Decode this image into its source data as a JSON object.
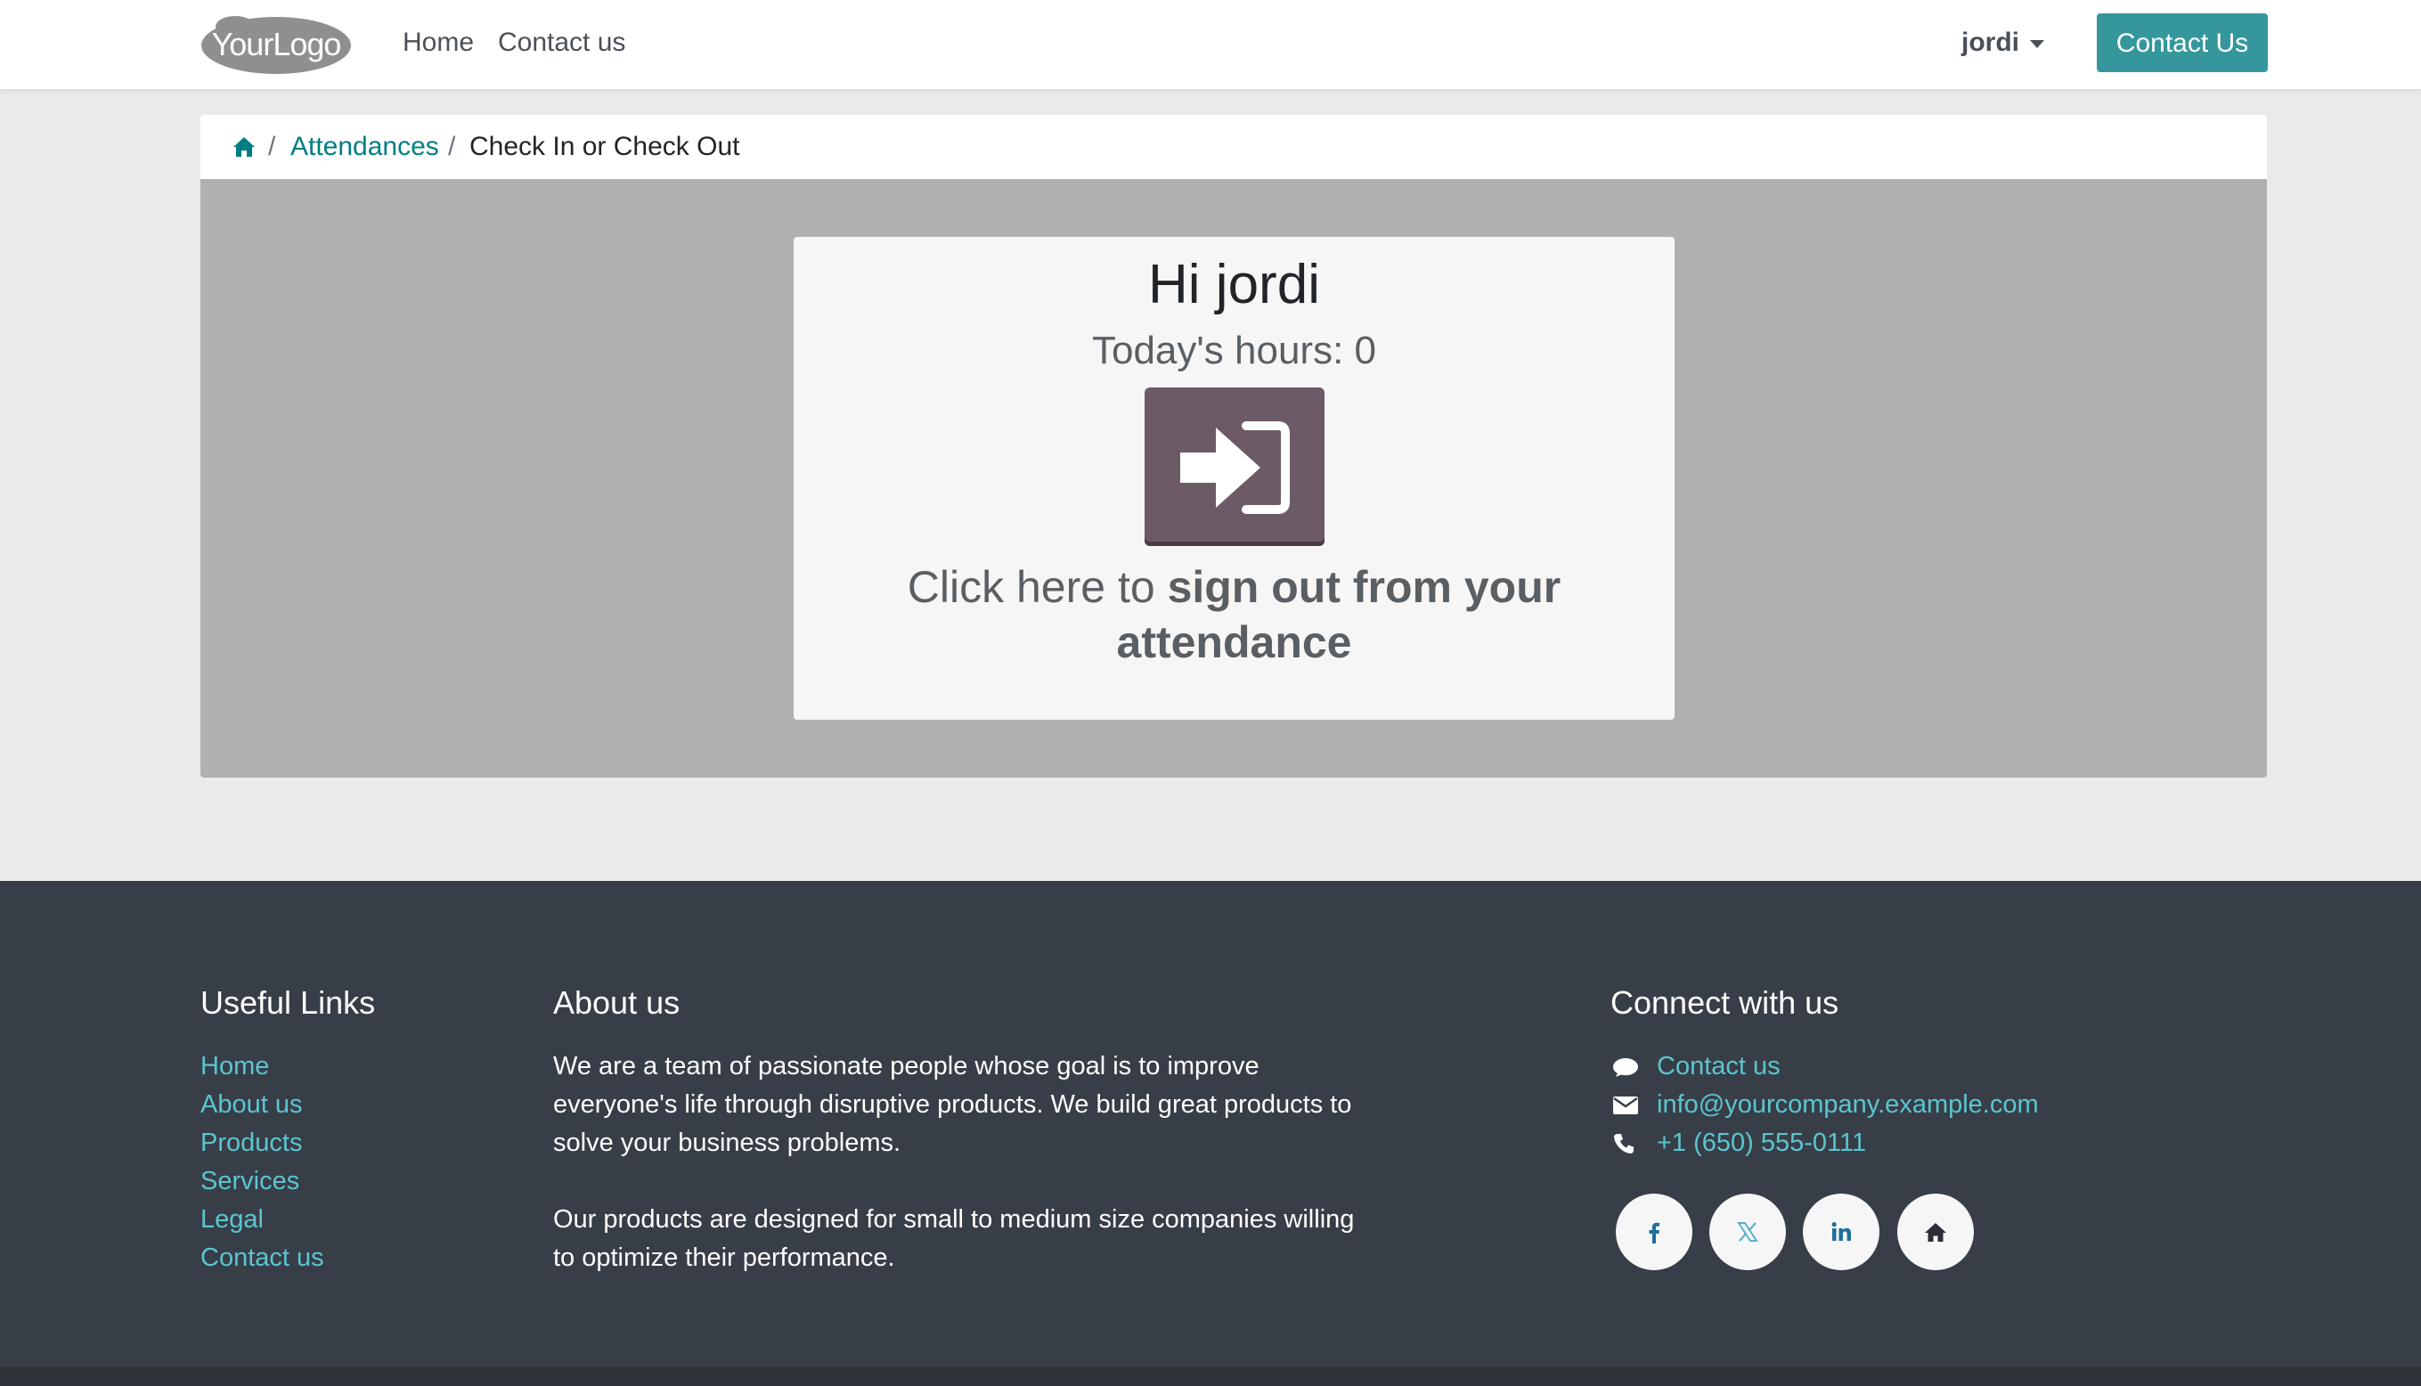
{
  "header": {
    "logo_text": "YourLogo",
    "nav": [
      {
        "label": "Home"
      },
      {
        "label": "Contact us"
      }
    ],
    "user_name": "jordi",
    "contact_button": "Contact Us"
  },
  "breadcrumb": {
    "home_icon": "home-icon",
    "attendances": "Attendances",
    "current": "Check In or Check Out",
    "separator": "/"
  },
  "attendance": {
    "greeting": "Hi jordi",
    "hours": "Today's hours: 0",
    "button_icon": "sign-in-arrow-icon",
    "prompt_prefix": "Click here to",
    "prompt_bold": "sign out from your attendance"
  },
  "footer": {
    "useful_links": {
      "heading": "Useful Links",
      "items": [
        {
          "label": "Home"
        },
        {
          "label": "About us"
        },
        {
          "label": "Products"
        },
        {
          "label": "Services"
        },
        {
          "label": "Legal"
        },
        {
          "label": "Contact us"
        }
      ]
    },
    "about": {
      "heading": "About us",
      "paragraphs": [
        "We are a team of passionate people whose goal is to improve everyone's life through disruptive products. We build great products to solve your business problems.",
        "Our products are designed for small to medium size companies willing to optimize their performance."
      ]
    },
    "connect": {
      "heading": "Connect with us",
      "items": [
        {
          "icon": "comment-icon",
          "label": "Contact us"
        },
        {
          "icon": "envelope-icon",
          "label": "info@yourcompany.example.com"
        },
        {
          "icon": "phone-icon",
          "label": "+1 (650) 555-0111"
        }
      ],
      "social": [
        "facebook-icon",
        "x-twitter-icon",
        "linkedin-icon",
        "home-icon"
      ]
    }
  },
  "colors": {
    "primary": "#35979c",
    "link": "#017e84",
    "footer_link": "#5ac6d0",
    "checkout_button": "#6c5a66",
    "footer_bg": "#383e47"
  }
}
